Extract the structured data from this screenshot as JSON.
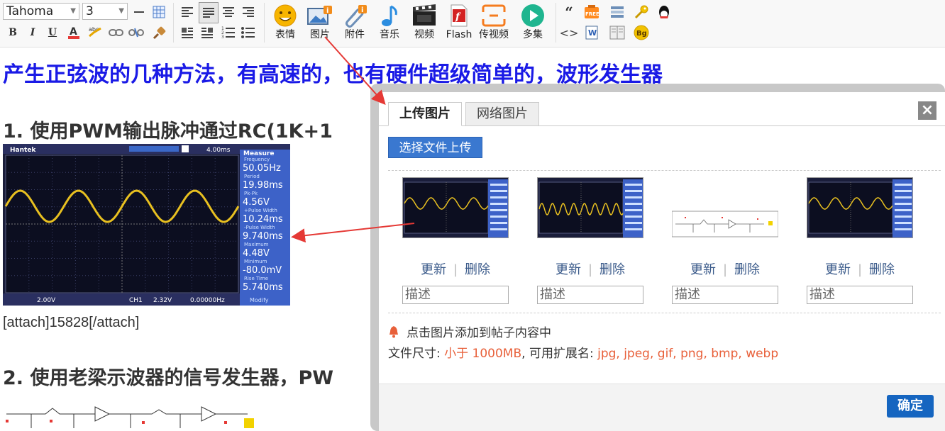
{
  "toolbar": {
    "font_name": "Tahoma",
    "font_size": "3",
    "media_buttons": [
      {
        "label": "表情",
        "icon": "emoji-icon"
      },
      {
        "label": "图片",
        "icon": "image-icon"
      },
      {
        "label": "附件",
        "icon": "attachment-icon"
      },
      {
        "label": "音乐",
        "icon": "music-icon"
      },
      {
        "label": "视频",
        "icon": "video-icon"
      },
      {
        "label": "Flash",
        "icon": "flash-icon"
      },
      {
        "label": "传视频",
        "icon": "upload-video-icon"
      },
      {
        "label": "多集",
        "icon": "play-series-icon"
      }
    ],
    "free_badge": "FREE",
    "bg_badge": "Bg",
    "doc_badge": "W"
  },
  "content": {
    "title": "产生正弦波的几种方法，有高速的，也有硬件超级简单的，波形发生器",
    "section1": "1. 使用PWM输出脉冲通过RC(1K+1",
    "attach_tag": "[attach]15828[/attach]",
    "section2": "2. 使用老梁示波器的信号发生器，PW"
  },
  "scope": {
    "brand": "Hantek",
    "timebase": "4.00ms",
    "measure_title": "Measure",
    "ch1_volts": "2.00V",
    "trigger": "CH1",
    "trigger_level": "2.32V",
    "freq_counter": "0.00000Hz",
    "modify": "Modify",
    "readings": [
      {
        "label": "Frequency",
        "value": "50.05Hz"
      },
      {
        "label": "Period",
        "value": "19.98ms"
      },
      {
        "label": "Pk-Pk",
        "value": "4.56V"
      },
      {
        "label": "+Pulse Width",
        "value": "10.24ms"
      },
      {
        "label": "-Pulse Width",
        "value": "9.740ms"
      },
      {
        "label": "Maximum",
        "value": "4.48V"
      },
      {
        "label": "Minimum",
        "value": "-80.0mV"
      },
      {
        "label": "Rise Time",
        "value": "5.740ms"
      }
    ]
  },
  "dialog": {
    "tabs": [
      "上传图片",
      "网络图片"
    ],
    "close": "×",
    "upload_button": "选择文件上传",
    "cards": [
      {
        "update": "更新",
        "delete": "删除",
        "placeholder": "描述",
        "kind": "scope"
      },
      {
        "update": "更新",
        "delete": "删除",
        "placeholder": "描述",
        "kind": "scope-fast"
      },
      {
        "update": "更新",
        "delete": "删除",
        "placeholder": "描述",
        "kind": "schematic"
      },
      {
        "update": "更新",
        "delete": "删除",
        "placeholder": "描述",
        "kind": "scope"
      }
    ],
    "separator": "|",
    "tip": "点击图片添加到帖子内容中",
    "size_label": "文件尺寸: ",
    "size_value": "小于 1000MB",
    "ext_label": ", 可用扩展名: ",
    "ext_value": "jpg, jpeg, gif, png, bmp, webp",
    "ok": "确定"
  },
  "colors": {
    "title": "#1a1ae6",
    "link_red": "#e8603a",
    "ok_button": "#1565c0",
    "upload_button": "#3a78d0",
    "scope_bg": "#1a1d3a",
    "wave": "#e8c020"
  }
}
